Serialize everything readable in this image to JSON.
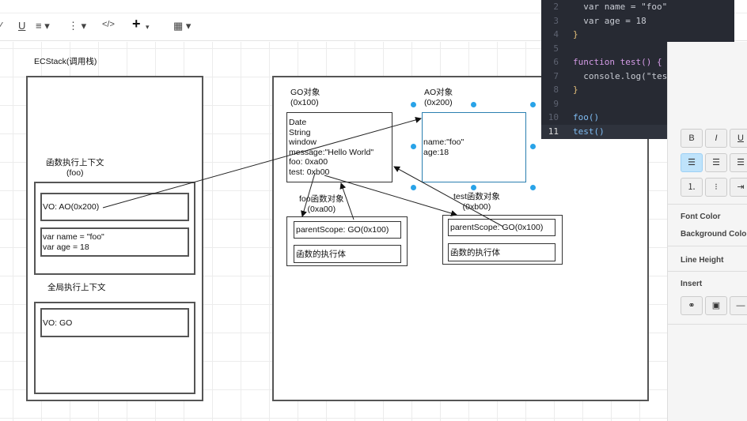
{
  "toolbar": {
    "icons": [
      "italic-icon",
      "underline-icon",
      "align-icon",
      "list-icon",
      "code-icon",
      "plus-icon",
      "table-icon"
    ],
    "underline": "U",
    "code": "</>",
    "plus": "+"
  },
  "diagram": {
    "ecstack_title": "ECStack(调用栈)",
    "foo_ctx_title": "函数执行上下文\n(foo)",
    "foo_vo": "VO: AO(0x200)",
    "foo_vars": "var name = \"foo\"\nvar age = 18",
    "global_ctx_title": "全局执行上下文",
    "global_vo": "VO: GO",
    "go_title": "GO对象\n(0x100)",
    "go_content": "Date\nString\nwindow\nmessage:\"Hello World\"\nfoo: 0xa00\ntest: 0xb00",
    "ao_title": "AO对象\n(0x200)",
    "ao_content": "name:\"foo\"\nage:18",
    "foo_obj_title": "foo函数对象\n(0xa00)",
    "foo_parent": "parentScope: GO(0x100)",
    "foo_body": "函数的执行体",
    "test_obj_title": "test函数对象\n(0xb00)",
    "test_parent": "parentScope: GO(0x100)",
    "test_body": "函数的执行体"
  },
  "code": {
    "lines": [
      {
        "n": "2",
        "t": "  var name = \"foo\""
      },
      {
        "n": "3",
        "t": "  var age = 18"
      },
      {
        "n": "4",
        "t": "}"
      },
      {
        "n": "5",
        "t": ""
      },
      {
        "n": "6",
        "t": "function test() {"
      },
      {
        "n": "7",
        "t": "  console.log(\"test\")"
      },
      {
        "n": "8",
        "t": "}"
      },
      {
        "n": "9",
        "t": ""
      },
      {
        "n": "10",
        "t": "foo()"
      },
      {
        "n": "11",
        "t": "test()"
      }
    ]
  },
  "panel": {
    "font_color": "Font Color",
    "background_color": "Background Color",
    "line_height": "Line Height",
    "insert": "Insert",
    "align_active_color": "#bfe3fb"
  }
}
